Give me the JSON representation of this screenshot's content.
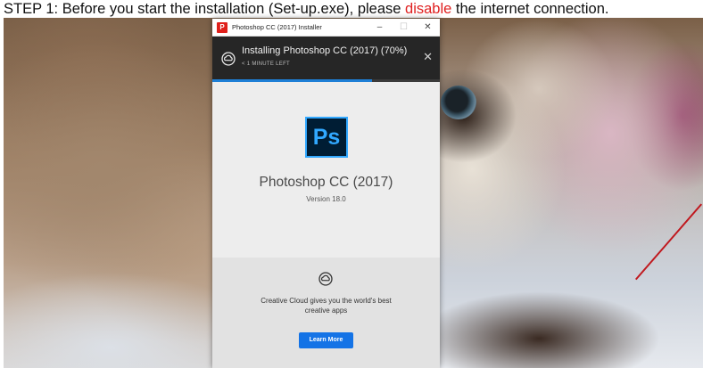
{
  "instruction": {
    "prefix": "STEP 1: Before you start the installation (Set-up.exe), please",
    "highlight": "disable",
    "suffix": "the internet connection."
  },
  "window": {
    "title": "Photoshop CC (2017) Installer",
    "minimize_glyph": "–",
    "maximize_glyph": "☐",
    "close_glyph": "✕"
  },
  "install": {
    "title": "Installing Photoshop CC (2017) (70%)",
    "time_left": "< 1 MINUTE LEFT",
    "progress_percent": 70,
    "close_glyph": "✕"
  },
  "product": {
    "logo_text": "Ps",
    "name": "Photoshop CC (2017)",
    "version": "Version 18.0"
  },
  "promo": {
    "text": "Creative Cloud gives you the world's best creative apps",
    "button_label": "Learn More"
  },
  "colors": {
    "accent_blue": "#1473e6",
    "progress_blue": "#1e7fd6",
    "ps_blue": "#31a8ff",
    "warning_red": "#e02020"
  },
  "icons": [
    "photoshop-app-icon",
    "creative-cloud-icon",
    "close-icon",
    "minimize-icon",
    "maximize-icon"
  ]
}
